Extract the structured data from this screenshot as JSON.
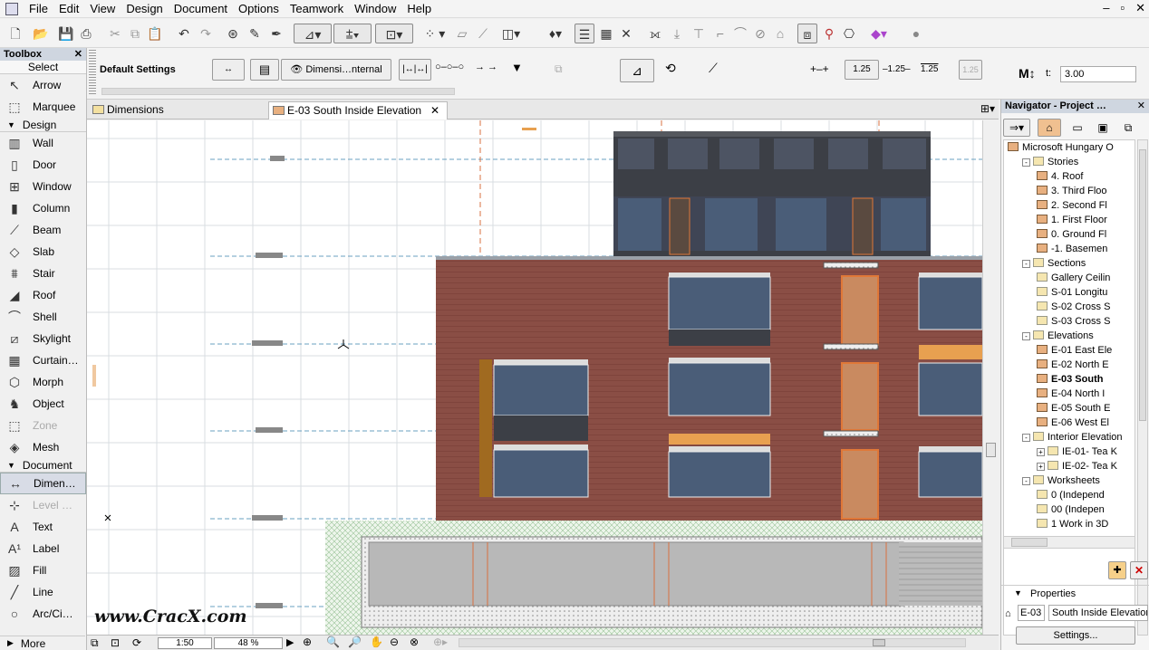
{
  "menu": [
    "File",
    "Edit",
    "View",
    "Design",
    "Document",
    "Options",
    "Teamwork",
    "Window",
    "Help"
  ],
  "window_controls": [
    "–",
    "▫",
    "✕"
  ],
  "toolbox": {
    "title": "Toolbox",
    "select_label": "Select",
    "top_items": [
      {
        "label": "Arrow",
        "icon": "arrow-icon"
      },
      {
        "label": "Marquee",
        "icon": "marquee-icon"
      }
    ],
    "design_label": "Design",
    "design_items": [
      {
        "label": "Wall",
        "icon": "wall-icon"
      },
      {
        "label": "Door",
        "icon": "door-icon"
      },
      {
        "label": "Window",
        "icon": "window-icon"
      },
      {
        "label": "Column",
        "icon": "column-icon"
      },
      {
        "label": "Beam",
        "icon": "beam-icon"
      },
      {
        "label": "Slab",
        "icon": "slab-icon"
      },
      {
        "label": "Stair",
        "icon": "stair-icon"
      },
      {
        "label": "Roof",
        "icon": "roof-icon"
      },
      {
        "label": "Shell",
        "icon": "shell-icon"
      },
      {
        "label": "Skylight",
        "icon": "skylight-icon"
      },
      {
        "label": "Curtain…",
        "icon": "curtain-wall-icon"
      },
      {
        "label": "Morph",
        "icon": "morph-icon"
      },
      {
        "label": "Object",
        "icon": "object-icon"
      },
      {
        "label": "Zone",
        "icon": "zone-icon",
        "disabled": true
      },
      {
        "label": "Mesh",
        "icon": "mesh-icon"
      }
    ],
    "document_label": "Document",
    "document_items": [
      {
        "label": "Dimen…",
        "icon": "dimension-icon",
        "selected": true
      },
      {
        "label": "Level …",
        "icon": "level-dimension-icon",
        "disabled": true
      },
      {
        "label": "Text",
        "icon": "text-icon"
      },
      {
        "label": "Label",
        "icon": "label-icon"
      },
      {
        "label": "Fill",
        "icon": "fill-icon"
      },
      {
        "label": "Line",
        "icon": "line-icon"
      },
      {
        "label": "Arc/Ci…",
        "icon": "arc-icon"
      }
    ],
    "more_label": "More"
  },
  "infobox": {
    "default_settings": "Default Settings",
    "dim_dropdown": "Dimensi…nternal",
    "val1": "1.25",
    "val2": "–1.25–",
    "val3": "1.25",
    "val4": "1.25",
    "t_label": "t:",
    "t_value": "3.00"
  },
  "tabs": [
    {
      "label": "Dimensions",
      "active": false
    },
    {
      "label": "E-03 South Inside Elevation",
      "active": true
    }
  ],
  "status": {
    "scale": "1:50",
    "zoom": "48 %"
  },
  "navigator": {
    "title": "Navigator - Project …",
    "tree": [
      {
        "label": "Microsoft Hungary O",
        "level": 0,
        "icon": "project"
      },
      {
        "label": "Stories",
        "level": 1,
        "icon": "folder",
        "pm": "-"
      },
      {
        "label": "4. Roof",
        "level": 2,
        "icon": "story"
      },
      {
        "label": "3. Third Floo",
        "level": 2,
        "icon": "story"
      },
      {
        "label": "2. Second Fl",
        "level": 2,
        "icon": "story"
      },
      {
        "label": "1. First Floor",
        "level": 2,
        "icon": "story"
      },
      {
        "label": "0. Ground Fl",
        "level": 2,
        "icon": "story"
      },
      {
        "label": "-1. Basemen",
        "level": 2,
        "icon": "story"
      },
      {
        "label": "Sections",
        "level": 1,
        "icon": "folder",
        "pm": "-"
      },
      {
        "label": "Gallery Ceilin",
        "level": 2,
        "icon": "section"
      },
      {
        "label": "S-01 Longitu",
        "level": 2,
        "icon": "section"
      },
      {
        "label": "S-02 Cross S",
        "level": 2,
        "icon": "section"
      },
      {
        "label": "S-03 Cross S",
        "level": 2,
        "icon": "section"
      },
      {
        "label": "Elevations",
        "level": 1,
        "icon": "folder",
        "pm": "-"
      },
      {
        "label": "E-01 East Ele",
        "level": 2,
        "icon": "elevation"
      },
      {
        "label": "E-02 North E",
        "level": 2,
        "icon": "elevation"
      },
      {
        "label": "E-03 South",
        "level": 2,
        "icon": "elevation",
        "bold": true
      },
      {
        "label": "E-04 North I",
        "level": 2,
        "icon": "elevation"
      },
      {
        "label": "E-05 South E",
        "level": 2,
        "icon": "elevation"
      },
      {
        "label": "E-06 West El",
        "level": 2,
        "icon": "elevation"
      },
      {
        "label": "Interior Elevation",
        "level": 1,
        "icon": "folder",
        "pm": "-"
      },
      {
        "label": "IE-01- Tea K",
        "level": 2,
        "icon": "ie",
        "pm": "+"
      },
      {
        "label": "IE-02- Tea K",
        "level": 2,
        "icon": "ie",
        "pm": "+"
      },
      {
        "label": "Worksheets",
        "level": 1,
        "icon": "folder",
        "pm": "-"
      },
      {
        "label": "0 (Independ",
        "level": 2,
        "icon": "sheet"
      },
      {
        "label": "00 (Indepen",
        "level": 2,
        "icon": "sheet"
      },
      {
        "label": "1 Work in 3D",
        "level": 2,
        "icon": "sheet"
      }
    ],
    "properties_label": "Properties",
    "prop_id": "E-03",
    "prop_name": "South Inside Elevatior",
    "settings_button": "Settings..."
  },
  "watermark": "www.CracX.com",
  "colors": {
    "brick": "#8a4e45",
    "glass": "#4a5d78",
    "accent": "#e8a050",
    "grid": "#c8d0d8"
  }
}
